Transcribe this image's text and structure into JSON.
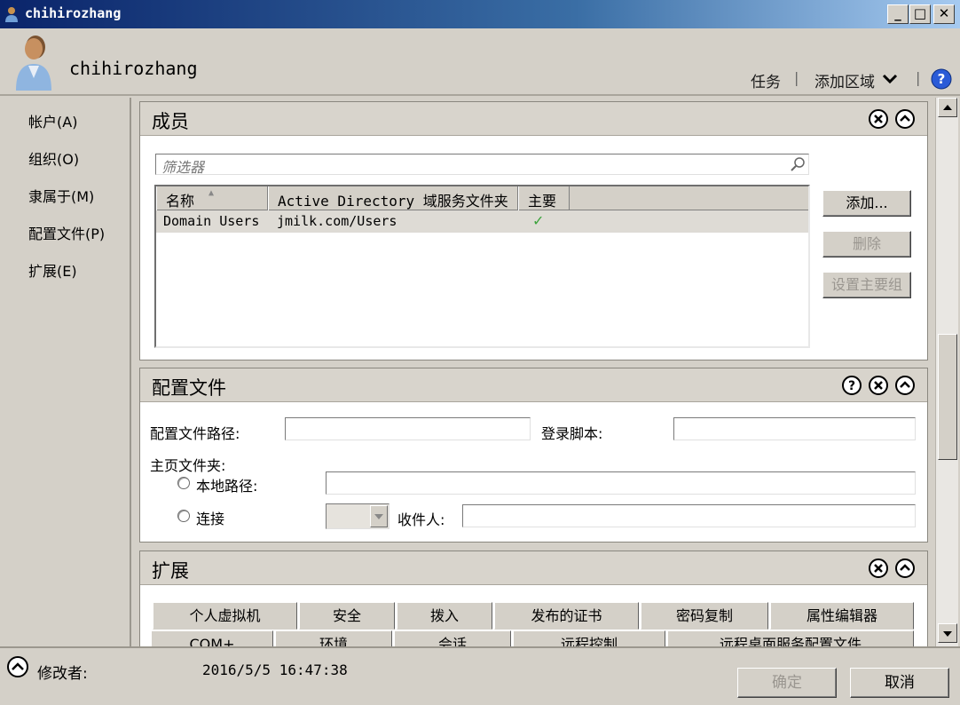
{
  "window": {
    "title": "chihirozhang"
  },
  "header": {
    "user_name": "chihirozhang",
    "tasks_label": "任务",
    "separator": "|",
    "add_section_label": "添加区域"
  },
  "nav": {
    "items": [
      {
        "label": "帐户(A)"
      },
      {
        "label": "组织(O)"
      },
      {
        "label": "隶属于(M)"
      },
      {
        "label": "配置文件(P)"
      },
      {
        "label": "扩展(E)"
      }
    ]
  },
  "members": {
    "title": "成员",
    "filter_placeholder": "筛选器",
    "columns": [
      "名称",
      "Active Directory 域服务文件夹",
      "主要"
    ],
    "rows": [
      {
        "name": "Domain Users",
        "path": "jmilk.com/Users",
        "primary": "✓"
      }
    ],
    "buttons": {
      "add": "添加...",
      "remove": "删除",
      "set_primary": "设置主要组"
    }
  },
  "profile": {
    "title": "配置文件",
    "profile_path_label": "配置文件路径:",
    "profile_path_value": "",
    "logon_script_label": "登录脚本:",
    "logon_script_value": "",
    "home_folder_label": "主页文件夹:",
    "local_path_label": "本地路径:",
    "local_path_value": "",
    "connect_label": "连接",
    "to_label": "收件人:",
    "to_value": ""
  },
  "extensions": {
    "title": "扩展",
    "tabs_row1": [
      "个人虚拟机",
      "安全",
      "拨入",
      "发布的证书",
      "密码复制",
      "属性编辑器"
    ],
    "tabs_row2": [
      "COM+",
      "环境",
      "会话",
      "远程控制",
      "远程桌面服务配置文件"
    ]
  },
  "footer": {
    "modified_by_label": "修改者:",
    "timestamp": "2016/5/5 16:47:38",
    "ok_label": "确定",
    "cancel_label": "取消"
  },
  "colors": {
    "title_bar": "#0a246a",
    "help_blue": "#2a5bd7",
    "check_green": "#3ca33c"
  }
}
